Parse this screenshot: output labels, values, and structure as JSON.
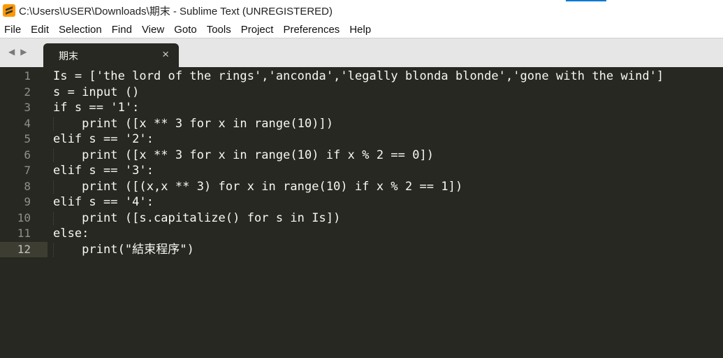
{
  "window": {
    "title": "C:\\Users\\USER\\Downloads\\期末 - Sublime Text (UNREGISTERED)"
  },
  "menu": [
    "File",
    "Edit",
    "Selection",
    "Find",
    "View",
    "Goto",
    "Tools",
    "Project",
    "Preferences",
    "Help"
  ],
  "tabbar": {
    "prev_arrow": "◀",
    "next_arrow": "▶",
    "tab_label": "期末",
    "close_glyph": "×"
  },
  "editor": {
    "current_line": 12,
    "lines": [
      {
        "num": "1",
        "code": "Is = ['the lord of the rings','anconda','legally blonda blonde','gone with the wind']"
      },
      {
        "num": "2",
        "code": "s = input ()"
      },
      {
        "num": "3",
        "code": "if s == '1':"
      },
      {
        "num": "4",
        "code": "    print ([x ** 3 for x in range(10)])"
      },
      {
        "num": "5",
        "code": "elif s == '2':"
      },
      {
        "num": "6",
        "code": "    print ([x ** 3 for x in range(10) if x % 2 == 0])"
      },
      {
        "num": "7",
        "code": "elif s == '3':"
      },
      {
        "num": "8",
        "code": "    print ([(x,x ** 3) for x in range(10) if x % 2 == 1])"
      },
      {
        "num": "9",
        "code": "elif s == '4':"
      },
      {
        "num": "10",
        "code": "    print ([s.capitalize() for s in Is])"
      },
      {
        "num": "11",
        "code": "else:"
      },
      {
        "num": "12",
        "code": "    print(\"結束程序\")"
      }
    ]
  },
  "colors": {
    "editor_bg": "#272822",
    "text": "#f8f8f2",
    "gutter_text": "#90908a",
    "current_line_gutter": "#3e3d32",
    "titlebar_accent": "#0078d7",
    "app_icon": "#ff9800"
  },
  "icons": {
    "app": "sublime-text-logo",
    "tab_close": "close-icon",
    "nav_prev": "caret-left-icon",
    "nav_next": "caret-right-icon"
  }
}
